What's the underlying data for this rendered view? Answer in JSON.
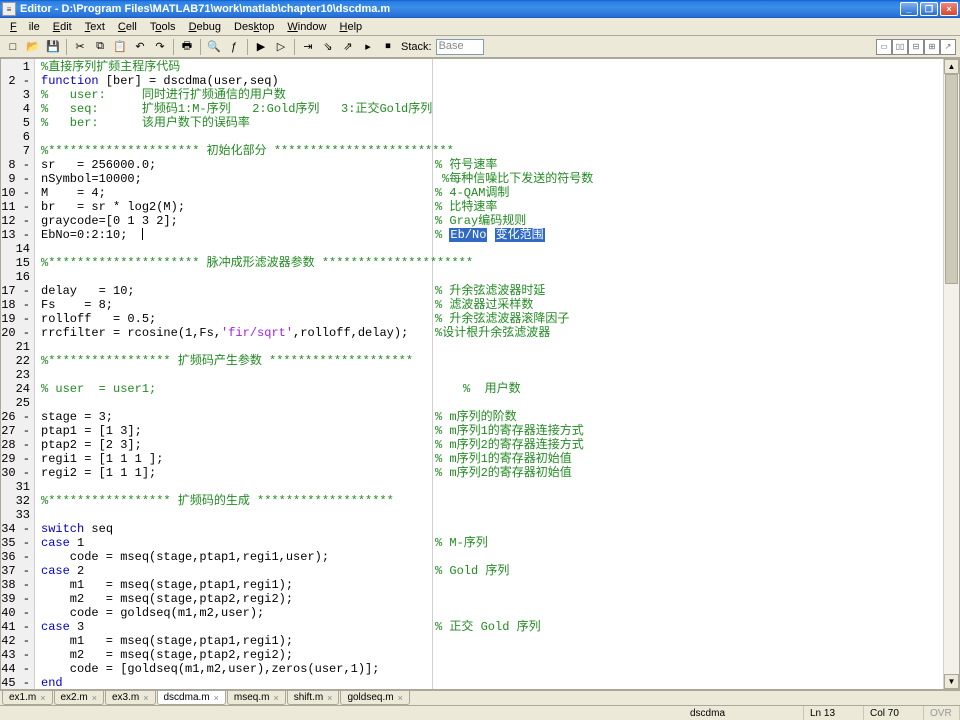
{
  "window": {
    "app_name": "Editor",
    "title": "Editor - D:\\Program Files\\MATLAB71\\work\\matlab\\chapter10\\dscdma.m",
    "minimize": "_",
    "maximize": "❐",
    "close": "×"
  },
  "menu": {
    "file": "File",
    "edit": "Edit",
    "text": "Text",
    "cell": "Cell",
    "tools": "Tools",
    "debug": "Debug",
    "desktop": "Desktop",
    "window": "Window",
    "help": "Help"
  },
  "toolbar": {
    "new": "□",
    "open": "📂",
    "save": "💾",
    "cut": "✂",
    "copy": "⧉",
    "paste": "📋",
    "undo": "↶",
    "redo": "↷",
    "print": "🖶",
    "find": "🔍",
    "fx": "ƒ",
    "set_clear": "▶",
    "clear_all": "▷",
    "step": "⇥",
    "run": "▸",
    "exit": "⏹",
    "stack_label": "Stack:",
    "stack_value": "Base"
  },
  "code": {
    "lines": [
      {
        "n": "1",
        "dash": "",
        "txt": "%直接序列扩频主程序代码",
        "cls": "c-comment"
      },
      {
        "n": "2",
        "dash": "-",
        "txt_parts": [
          {
            "t": "function",
            "c": "c-kw"
          },
          {
            "t": " [ber] = dscdma(user,seq)",
            "c": ""
          }
        ]
      },
      {
        "n": "3",
        "dash": "",
        "txt": "%   user:     同时进行扩频通信的用户数",
        "cls": "c-comment"
      },
      {
        "n": "4",
        "dash": "",
        "txt": "%   seq:      扩频码1:M-序列   2:Gold序列   3:正交Gold序列",
        "cls": "c-comment"
      },
      {
        "n": "5",
        "dash": "",
        "txt": "%   ber:      该用户数下的误码率",
        "cls": "c-comment"
      },
      {
        "n": "6",
        "dash": "",
        "txt": ""
      },
      {
        "n": "7",
        "dash": "",
        "txt": "%********************* 初始化部分 *************************",
        "cls": "c-comment"
      },
      {
        "n": "8",
        "dash": "-",
        "txt": "sr   = 256000.0;",
        "cmt": "% 符号速率",
        "col": 400
      },
      {
        "n": "9",
        "dash": "-",
        "txt": "nSymbol=10000;",
        "cmt": "%每种信噪比下发送的符号数",
        "col": 407
      },
      {
        "n": "10",
        "dash": "-",
        "txt": "M    = 4;",
        "cmt": "% 4-QAM调制",
        "col": 400
      },
      {
        "n": "11",
        "dash": "-",
        "txt": "br   = sr * log2(M);",
        "cmt": "% 比特速率",
        "col": 400
      },
      {
        "n": "12",
        "dash": "-",
        "txt": "graycode=[0 1 3 2];",
        "cmt": "% Gray编码规则",
        "col": 400
      },
      {
        "n": "13",
        "dash": "-",
        "txt_parts": [
          {
            "t": "EbNo=0:2:10;  ",
            "c": ""
          },
          {
            "t": "|",
            "c": "cursor-ph"
          }
        ],
        "sel": {
          "pre": "% ",
          "h1": "Eb/No",
          "mid": " ",
          "h2": "变化范围"
        },
        "col": 400
      },
      {
        "n": "14",
        "dash": "",
        "txt": ""
      },
      {
        "n": "15",
        "dash": "",
        "txt": "%********************* 脉冲成形滤波器参数 *********************",
        "cls": "c-comment"
      },
      {
        "n": "16",
        "dash": "",
        "txt": ""
      },
      {
        "n": "17",
        "dash": "-",
        "txt": "delay   = 10;",
        "cmt": "% 升余弦滤波器时延",
        "col": 400
      },
      {
        "n": "18",
        "dash": "-",
        "txt": "Fs    = 8;",
        "cmt": "% 滤波器过采样数",
        "col": 400
      },
      {
        "n": "19",
        "dash": "-",
        "txt": "rolloff   = 0.5;",
        "cmt": "% 升余弦滤波器滚降因子",
        "col": 400
      },
      {
        "n": "20",
        "dash": "-",
        "txt_parts": [
          {
            "t": "rrcfilter = rcosine(1,Fs,",
            "c": ""
          },
          {
            "t": "'fir/sqrt'",
            "c": "c-str"
          },
          {
            "t": ",rolloff,delay);",
            "c": ""
          }
        ],
        "cmt": "%设计根升余弦滤波器",
        "col": 400
      },
      {
        "n": "21",
        "dash": "",
        "txt": ""
      },
      {
        "n": "22",
        "dash": "",
        "txt": "%***************** 扩频码产生参数 ********************",
        "cls": "c-comment"
      },
      {
        "n": "23",
        "dash": "",
        "txt": ""
      },
      {
        "n": "24",
        "dash": "",
        "txt": "% user  = user1;",
        "cls": "c-comment",
        "cmt": "%  用户数",
        "col": 428
      },
      {
        "n": "25",
        "dash": "",
        "txt": ""
      },
      {
        "n": "26",
        "dash": "-",
        "txt": "stage = 3;",
        "cmt": "% m序列的阶数",
        "col": 400
      },
      {
        "n": "27",
        "dash": "-",
        "txt": "ptap1 = [1 3];",
        "cmt": "% m序列1的寄存器连接方式",
        "col": 400
      },
      {
        "n": "28",
        "dash": "-",
        "txt": "ptap2 = [2 3];",
        "cmt": "% m序列2的寄存器连接方式",
        "col": 400
      },
      {
        "n": "29",
        "dash": "-",
        "txt": "regi1 = [1 1 1 ];",
        "cmt": "% m序列1的寄存器初始值",
        "col": 400
      },
      {
        "n": "30",
        "dash": "-",
        "txt": "regi2 = [1 1 1];",
        "cmt": "% m序列2的寄存器初始值",
        "col": 400
      },
      {
        "n": "31",
        "dash": "",
        "txt": ""
      },
      {
        "n": "32",
        "dash": "",
        "txt": "%***************** 扩频码的生成 *******************",
        "cls": "c-comment"
      },
      {
        "n": "33",
        "dash": "",
        "txt": ""
      },
      {
        "n": "34",
        "dash": "-",
        "txt_parts": [
          {
            "t": "switch",
            "c": "c-kw"
          },
          {
            "t": " seq",
            "c": ""
          }
        ]
      },
      {
        "n": "35",
        "dash": "-",
        "txt_parts": [
          {
            "t": "case",
            "c": "c-kw"
          },
          {
            "t": " 1",
            "c": ""
          }
        ],
        "cmt": "% M-序列",
        "col": 400
      },
      {
        "n": "36",
        "dash": "-",
        "txt": "    code = mseq(stage,ptap1,regi1,user);"
      },
      {
        "n": "37",
        "dash": "-",
        "txt_parts": [
          {
            "t": "case",
            "c": "c-kw"
          },
          {
            "t": " 2",
            "c": ""
          }
        ],
        "cmt": "% Gold 序列",
        "col": 400
      },
      {
        "n": "38",
        "dash": "-",
        "txt": "    m1   = mseq(stage,ptap1,regi1);"
      },
      {
        "n": "39",
        "dash": "-",
        "txt": "    m2   = mseq(stage,ptap2,regi2);"
      },
      {
        "n": "40",
        "dash": "-",
        "txt": "    code = goldseq(m1,m2,user);"
      },
      {
        "n": "41",
        "dash": "-",
        "txt_parts": [
          {
            "t": "case",
            "c": "c-kw"
          },
          {
            "t": " 3",
            "c": ""
          }
        ],
        "cmt": "% 正交 Gold 序列",
        "col": 400
      },
      {
        "n": "42",
        "dash": "-",
        "txt": "    m1   = mseq(stage,ptap1,regi1);"
      },
      {
        "n": "43",
        "dash": "-",
        "txt": "    m2   = mseq(stage,ptap2,regi2);"
      },
      {
        "n": "44",
        "dash": "-",
        "txt": "    code = [goldseq(m1,m2,user),zeros(user,1)];"
      },
      {
        "n": "45",
        "dash": "-",
        "txt_parts": [
          {
            "t": "end",
            "c": "c-kw"
          }
        ]
      }
    ]
  },
  "tabs": {
    "items": [
      {
        "label": "ex1.m",
        "active": false
      },
      {
        "label": "ex2.m",
        "active": false
      },
      {
        "label": "ex3.m",
        "active": false
      },
      {
        "label": "dscdma.m",
        "active": true
      },
      {
        "label": "mseq.m",
        "active": false
      },
      {
        "label": "shift.m",
        "active": false
      },
      {
        "label": "goldseq.m",
        "active": false
      }
    ],
    "close_glyph": "×"
  },
  "status": {
    "func": "dscdma",
    "ln_label": "Ln",
    "ln": "13",
    "col_label": "Col",
    "col": "70",
    "ovr": "OVR"
  }
}
